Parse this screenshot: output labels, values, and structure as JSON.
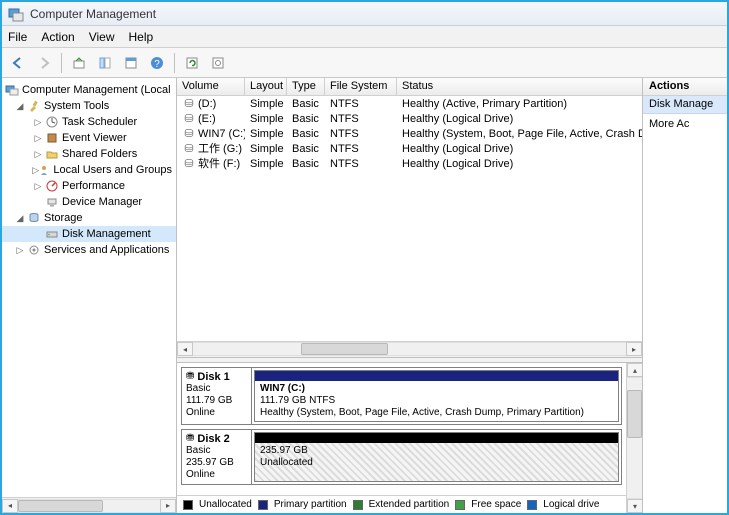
{
  "title": "Computer Management",
  "menu": {
    "file": "File",
    "action": "Action",
    "view": "View",
    "help": "Help"
  },
  "tree": {
    "root": "Computer Management (Local",
    "system_tools": "System Tools",
    "task_scheduler": "Task Scheduler",
    "event_viewer": "Event Viewer",
    "shared_folders": "Shared Folders",
    "local_users": "Local Users and Groups",
    "performance": "Performance",
    "device_manager": "Device Manager",
    "storage": "Storage",
    "disk_management": "Disk Management",
    "services_apps": "Services and Applications"
  },
  "columns": {
    "volume": "Volume",
    "layout": "Layout",
    "type": "Type",
    "fs": "File System",
    "status": "Status"
  },
  "volumes": [
    {
      "name": "(D:)",
      "layout": "Simple",
      "type": "Basic",
      "fs": "NTFS",
      "status": "Healthy (Active, Primary Partition)"
    },
    {
      "name": "(E:)",
      "layout": "Simple",
      "type": "Basic",
      "fs": "NTFS",
      "status": "Healthy (Logical Drive)"
    },
    {
      "name": "WIN7 (C:)",
      "layout": "Simple",
      "type": "Basic",
      "fs": "NTFS",
      "status": "Healthy (System, Boot, Page File, Active, Crash Dump, Primary Par"
    },
    {
      "name": "工作 (G:)",
      "layout": "Simple",
      "type": "Basic",
      "fs": "NTFS",
      "status": "Healthy (Logical Drive)"
    },
    {
      "name": "软件 (F:)",
      "layout": "Simple",
      "type": "Basic",
      "fs": "NTFS",
      "status": "Healthy (Logical Drive)"
    }
  ],
  "disks": [
    {
      "label": "Disk 1",
      "type": "Basic",
      "size": "111.79 GB",
      "state": "Online",
      "part_color": "#1a237e",
      "part_title": "WIN7  (C:)",
      "part_line2": "111.79 GB NTFS",
      "part_line3": "Healthy (System, Boot, Page File, Active, Crash Dump, Primary Partition)"
    },
    {
      "label": "Disk 2",
      "type": "Basic",
      "size": "235.97 GB",
      "state": "Online",
      "part_color": "#000000",
      "part_line2": "235.97 GB",
      "part_line3": "Unallocated",
      "hatched": true
    }
  ],
  "legend": {
    "unallocated": "Unallocated",
    "primary": "Primary partition",
    "extended": "Extended partition",
    "free": "Free space",
    "logical": "Logical drive",
    "colors": {
      "unallocated": "#000000",
      "primary": "#1a237e",
      "extended": "#2e7d32",
      "free": "#43a047",
      "logical": "#1565c0"
    }
  },
  "actions": {
    "header": "Actions",
    "context": "Disk Manage",
    "more": "More Ac"
  }
}
